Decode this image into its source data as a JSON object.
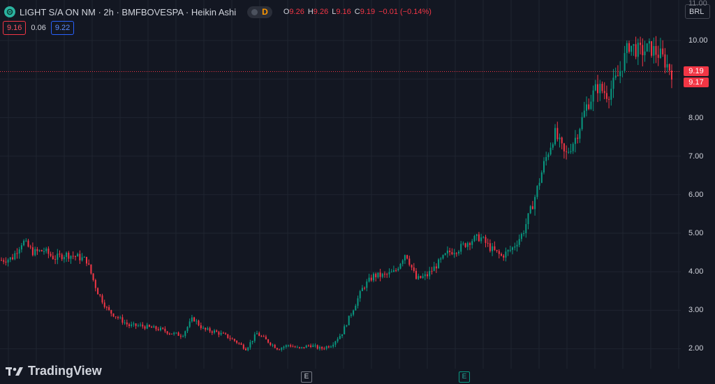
{
  "header": {
    "symbol_title": "LIGHT S/A ON NM · 2h · BMFBOVESPA · Heikin Ashi",
    "badge": "D",
    "ohlc": {
      "open_key": "O",
      "open": "9.26",
      "high_key": "H",
      "high": "9.26",
      "low_key": "L",
      "low": "9.16",
      "close_key": "C",
      "close": "9.19",
      "change": "−0.01 (−0.14%)"
    }
  },
  "price_bar": {
    "sell": "9.16",
    "spread": "0.06",
    "buy": "9.22"
  },
  "axis": {
    "currency": "BRL",
    "top_partial": "11.00",
    "labels": [
      "10.00",
      "9.00",
      "8.00",
      "7.00",
      "6.00",
      "5.00",
      "4.00",
      "3.00",
      "2.00"
    ]
  },
  "tags": {
    "last_price": "9.19",
    "second_price": "9.17"
  },
  "events": {
    "earnings_1": "E",
    "earnings_2": "E"
  },
  "brand": {
    "name": "TradingView"
  },
  "colors": {
    "up": "#089981",
    "down": "#f23645",
    "background": "#131722",
    "grid": "#1f2430",
    "accent": "#2962ff"
  },
  "chart_data": {
    "type": "candlestick",
    "title": "LIGHT S/A ON NM · 2h · BMFBOVESPA · Heikin Ashi",
    "ylim": [
      1.5,
      11.0
    ],
    "yticks": [
      2,
      3,
      4,
      5,
      6,
      7,
      8,
      9,
      10
    ],
    "approx_closes": [
      4.3,
      4.35,
      4.8,
      4.5,
      4.55,
      4.35,
      4.45,
      4.4,
      4.3,
      3.5,
      3.0,
      2.8,
      2.6,
      2.6,
      2.55,
      2.5,
      2.4,
      2.35,
      2.8,
      2.5,
      2.45,
      2.35,
      2.2,
      2.0,
      2.4,
      2.2,
      2.0,
      2.1,
      2.0,
      2.1,
      2.0,
      2.1,
      2.4,
      3.0,
      3.6,
      3.9,
      3.9,
      4.0,
      4.5,
      3.8,
      3.9,
      4.2,
      4.5,
      4.6,
      4.8,
      4.9,
      4.6,
      4.4,
      4.6,
      5.0,
      5.8,
      6.8,
      7.6,
      7.0,
      7.5,
      8.3,
      8.8,
      8.6,
      9.1,
      9.9,
      9.7,
      9.8,
      9.6,
      9.19
    ],
    "last": 9.19
  }
}
